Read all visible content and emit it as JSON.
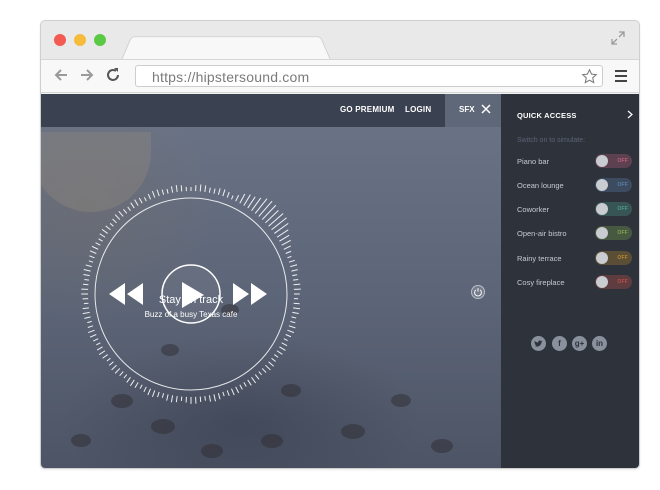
{
  "browser": {
    "url": "https://hipstersound.com"
  },
  "topnav": {
    "premium": "GO PREMIUM",
    "login": "LOGIN",
    "sfx": "SFX"
  },
  "player": {
    "title": "Stay on track",
    "subtitle": "Buzz of a busy Texas cafe"
  },
  "quick_access": {
    "title": "QUICK ACCESS",
    "hint": "Switch on to simulate:",
    "items": [
      {
        "label": "Piano bar",
        "state": "OFF",
        "color": "#c0607a"
      },
      {
        "label": "Ocean lounge",
        "state": "OFF",
        "color": "#5b7fa8"
      },
      {
        "label": "Coworker",
        "state": "OFF",
        "color": "#4f9b8a"
      },
      {
        "label": "Open-air bistro",
        "state": "OFF",
        "color": "#7ea84e"
      },
      {
        "label": "Rainy terrace",
        "state": "OFF",
        "color": "#b8872e"
      },
      {
        "label": "Cosy fireplace",
        "state": "OFF",
        "color": "#c0504a"
      }
    ]
  },
  "socials": {
    "twitter": "twitter-icon",
    "facebook": "f",
    "google": "g+",
    "linkedin": "in"
  },
  "colors": {
    "sidebar_bg": "#2d323b",
    "topbar_bg": "#3a4150",
    "hero_bg": "#5c6577"
  }
}
